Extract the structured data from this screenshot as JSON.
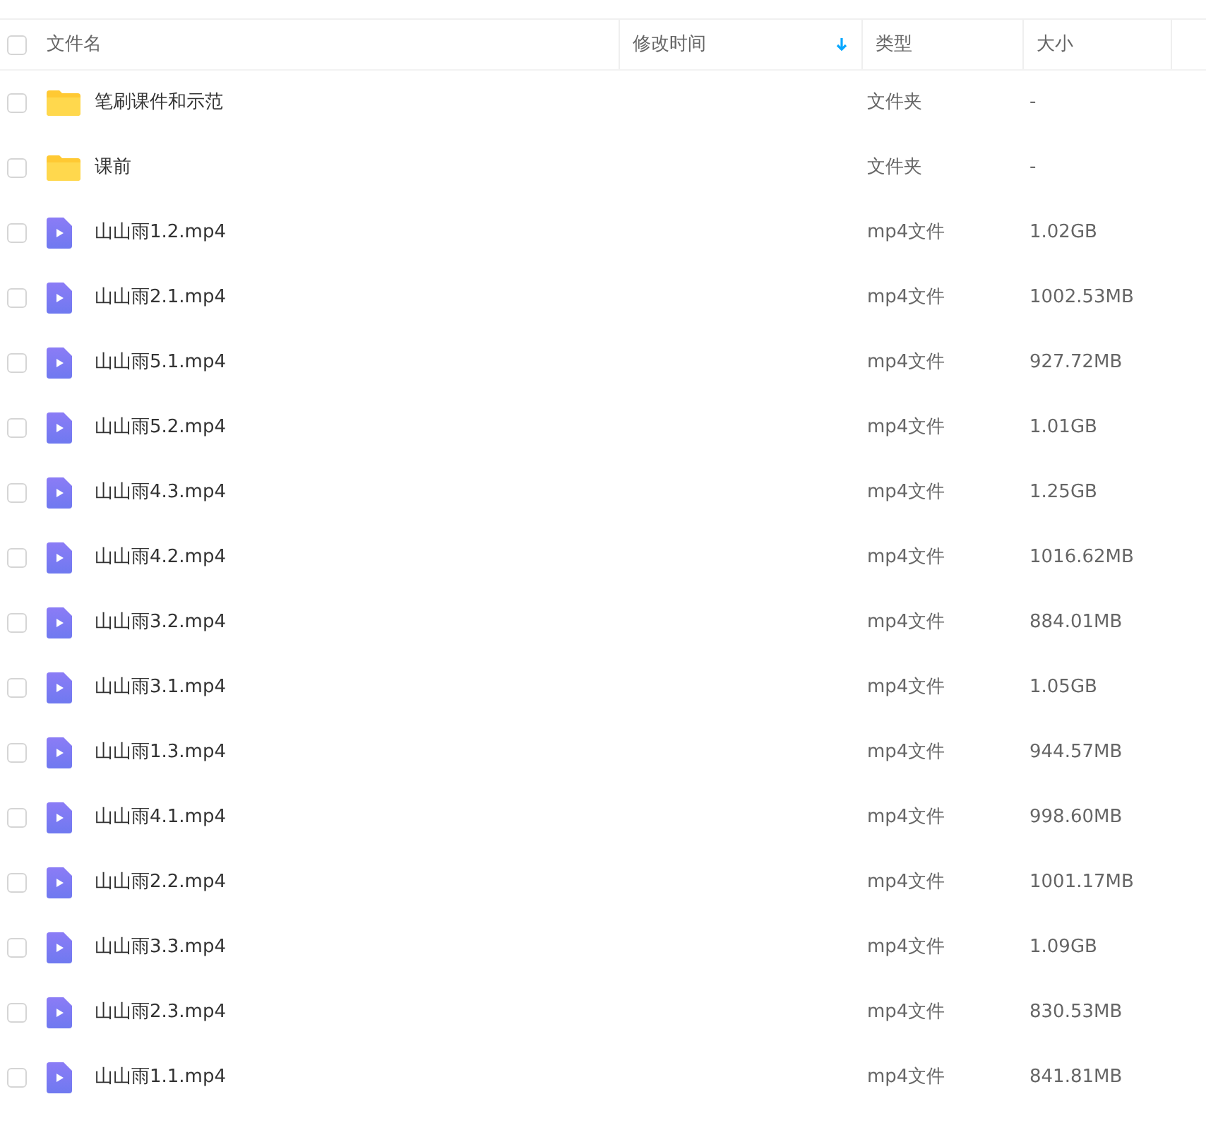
{
  "header": {
    "checked": false,
    "columns": [
      {
        "label": "文件名",
        "sorted": false
      },
      {
        "label": "修改时间",
        "sorted": true
      },
      {
        "label": "类型",
        "sorted": false
      },
      {
        "label": "大小",
        "sorted": false
      }
    ]
  },
  "rows": [
    {
      "kind": "folder",
      "name": "笔刷课件和示范",
      "type": "文件夹",
      "size": "-",
      "checked": false
    },
    {
      "kind": "folder",
      "name": "课前",
      "type": "文件夹",
      "size": "-",
      "checked": false
    },
    {
      "kind": "video",
      "name": "山山雨1.2.mp4",
      "type": "mp4文件",
      "size": "1.02GB",
      "checked": false
    },
    {
      "kind": "video",
      "name": "山山雨2.1.mp4",
      "type": "mp4文件",
      "size": "1002.53MB",
      "checked": false
    },
    {
      "kind": "video",
      "name": "山山雨5.1.mp4",
      "type": "mp4文件",
      "size": "927.72MB",
      "checked": false
    },
    {
      "kind": "video",
      "name": "山山雨5.2.mp4",
      "type": "mp4文件",
      "size": "1.01GB",
      "checked": false
    },
    {
      "kind": "video",
      "name": "山山雨4.3.mp4",
      "type": "mp4文件",
      "size": "1.25GB",
      "checked": false
    },
    {
      "kind": "video",
      "name": "山山雨4.2.mp4",
      "type": "mp4文件",
      "size": "1016.62MB",
      "checked": false
    },
    {
      "kind": "video",
      "name": "山山雨3.2.mp4",
      "type": "mp4文件",
      "size": "884.01MB",
      "checked": false
    },
    {
      "kind": "video",
      "name": "山山雨3.1.mp4",
      "type": "mp4文件",
      "size": "1.05GB",
      "checked": false
    },
    {
      "kind": "video",
      "name": "山山雨1.3.mp4",
      "type": "mp4文件",
      "size": "944.57MB",
      "checked": false
    },
    {
      "kind": "video",
      "name": "山山雨4.1.mp4",
      "type": "mp4文件",
      "size": "998.60MB",
      "checked": false
    },
    {
      "kind": "video",
      "name": "山山雨2.2.mp4",
      "type": "mp4文件",
      "size": "1001.17MB",
      "checked": false
    },
    {
      "kind": "video",
      "name": "山山雨3.3.mp4",
      "type": "mp4文件",
      "size": "1.09GB",
      "checked": false
    },
    {
      "kind": "video",
      "name": "山山雨2.3.mp4",
      "type": "mp4文件",
      "size": "830.53MB",
      "checked": false
    },
    {
      "kind": "video",
      "name": "山山雨1.1.mp4",
      "type": "mp4文件",
      "size": "841.81MB",
      "checked": false
    }
  ]
}
